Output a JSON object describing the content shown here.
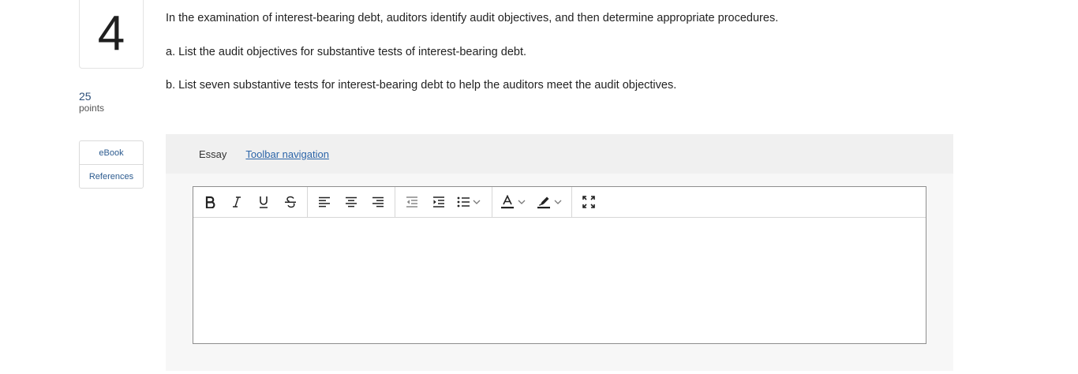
{
  "question": {
    "number": "4",
    "points_value": "25",
    "points_label": "points",
    "paragraphs": [
      "In the examination of interest-bearing debt, auditors identify audit objectives, and then determine appropriate procedures.",
      "a. List the audit objectives for substantive tests of interest-bearing debt.",
      "b. List seven substantive tests for interest-bearing debt to help the auditors meet the audit objectives."
    ]
  },
  "side_links": [
    {
      "label": "eBook"
    },
    {
      "label": "References"
    }
  ],
  "essay": {
    "label": "Essay",
    "toolbar_nav_label": "Toolbar navigation",
    "editor_value": ""
  },
  "toolbar": {
    "icons": [
      "bold-icon",
      "italic-icon",
      "underline-icon",
      "strikethrough-icon",
      "align-left-icon",
      "align-center-icon",
      "align-right-icon",
      "outdent-icon",
      "indent-icon",
      "bulleted-list-icon",
      "font-color-icon",
      "highlight-icon",
      "fullscreen-icon"
    ]
  },
  "colors": {
    "link": "#2b64a8",
    "points": "#2c4f7a",
    "panel": "#f7f7f7"
  }
}
